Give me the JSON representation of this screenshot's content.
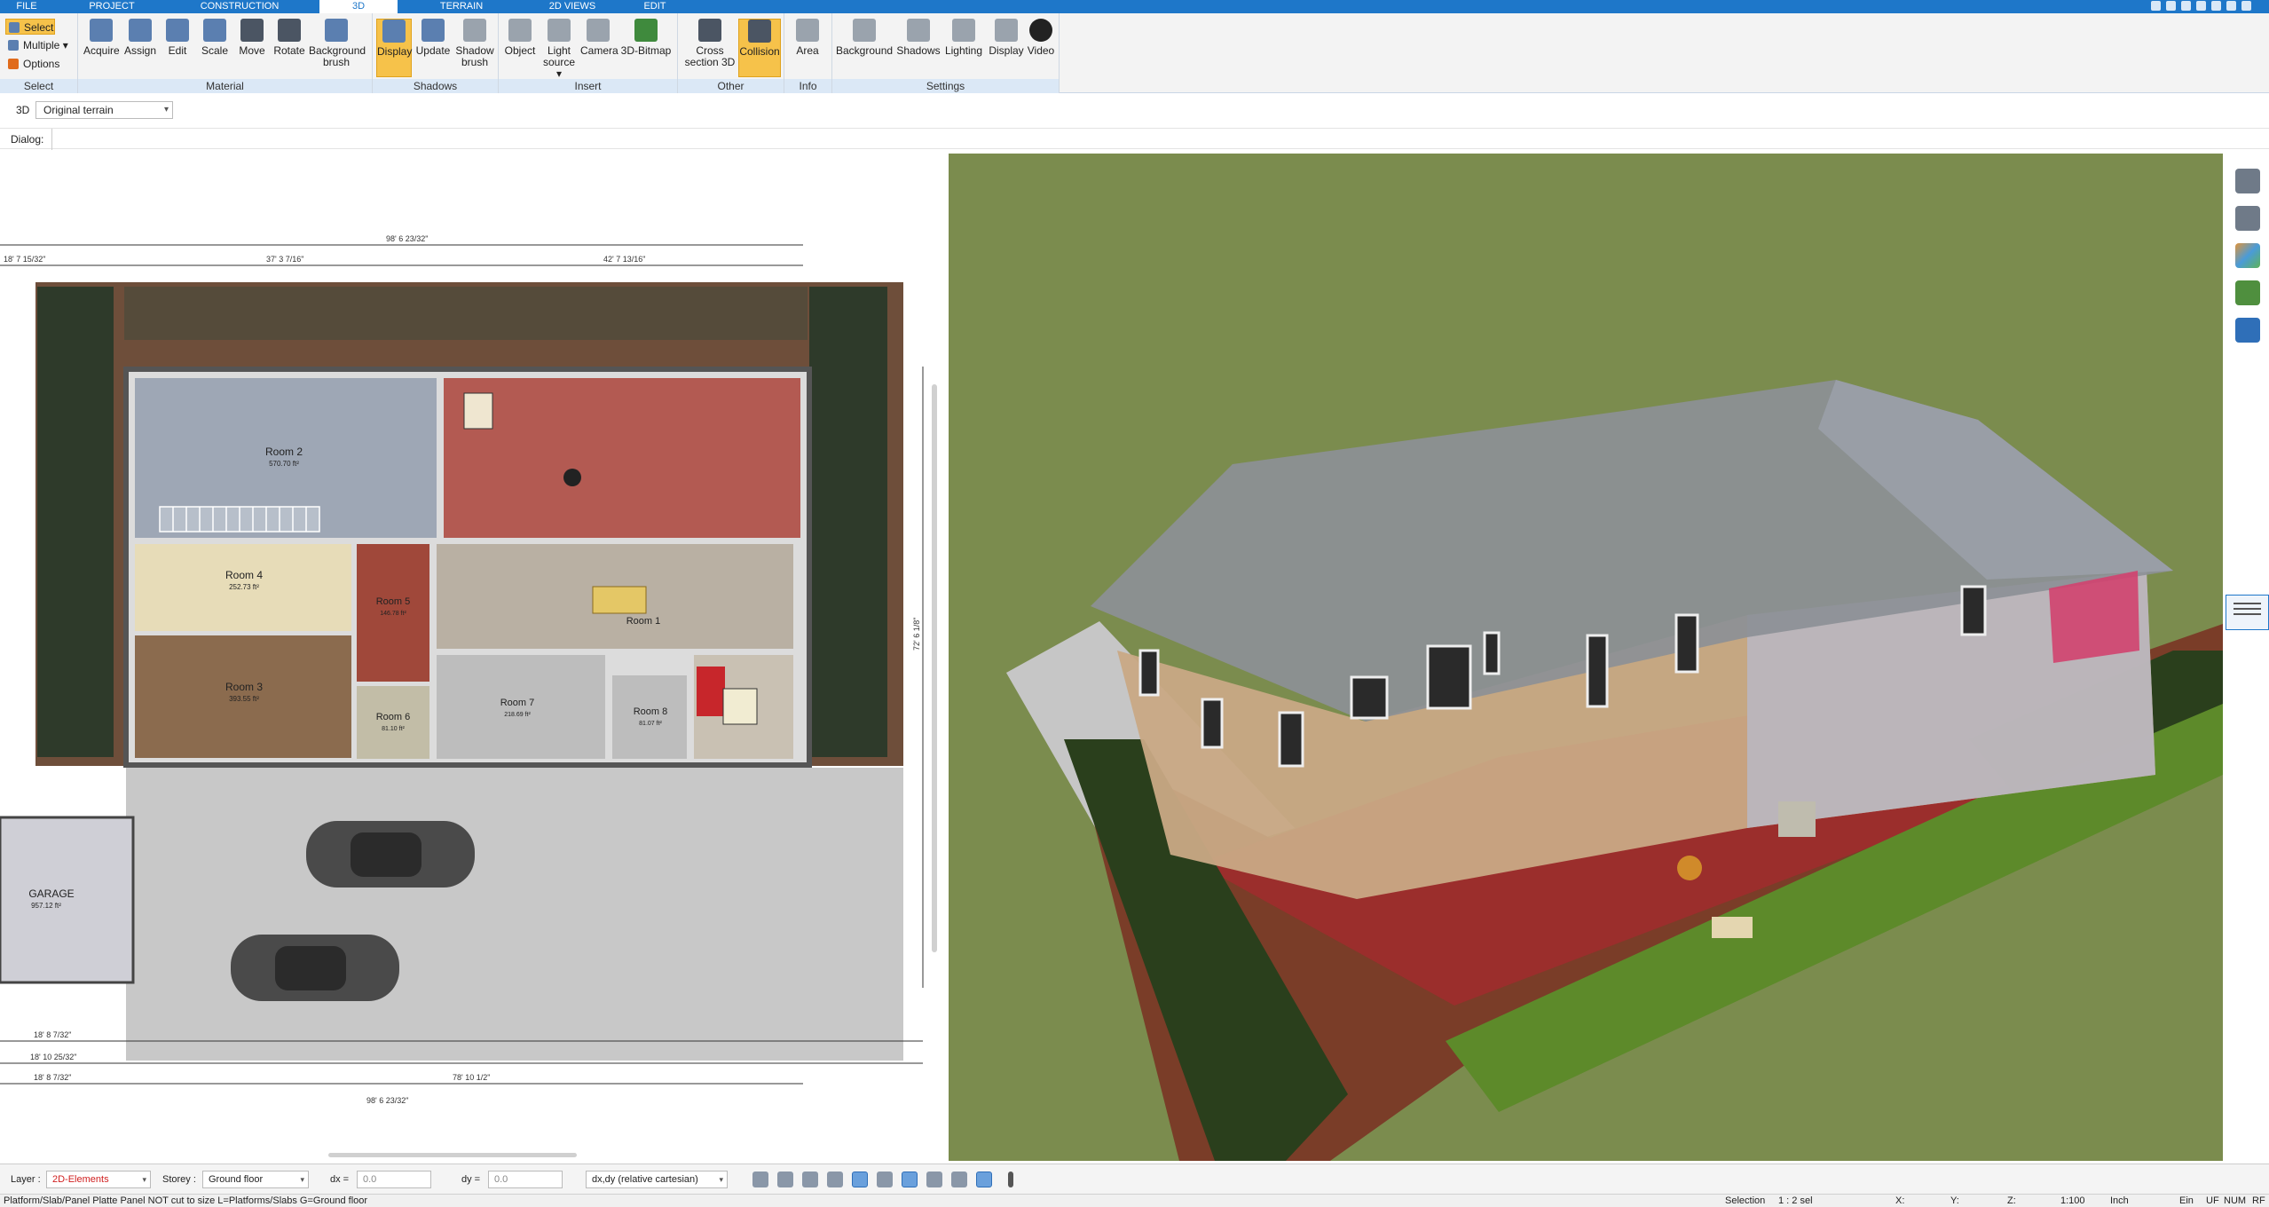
{
  "menu_tabs": [
    "FILE",
    "PROJECT",
    "CONSTRUCTION",
    "3D",
    "TERRAIN",
    "2D VIEWS",
    "EDIT"
  ],
  "ribbon": {
    "select_group": {
      "select": "Select",
      "multiple": "Multiple",
      "options": "Options",
      "label": "Select"
    },
    "material_group": {
      "buttons": [
        "Acquire",
        "Assign",
        "Edit",
        "Scale",
        "Move",
        "Rotate"
      ],
      "background_brush": [
        "Background",
        "brush"
      ],
      "label": "Material"
    },
    "shadows_group": {
      "display": "Display",
      "update": "Update",
      "shadow_brush": [
        "Shadow",
        "brush"
      ],
      "label": "Shadows"
    },
    "insert_group": {
      "object": "Object",
      "light_source": [
        "Light",
        "source"
      ],
      "camera": "Camera",
      "bitmap": "3D-Bitmap",
      "label": "Insert"
    },
    "other_group": {
      "cross_section": [
        "Cross",
        "section 3D"
      ],
      "collision": "Collision",
      "label": "Other"
    },
    "info_group": {
      "area": "Area",
      "label": "Info"
    },
    "settings_group": {
      "buttons": [
        "Background",
        "Shadows",
        "Lighting",
        "Display",
        "Video"
      ],
      "label": "Settings"
    }
  },
  "context": {
    "mode": "3D",
    "terrain": "Original terrain",
    "dialog_label": "Dialog:"
  },
  "plan": {
    "rooms": [
      {
        "name": "Room 2",
        "area": "570.70 ft²"
      },
      {
        "name": "Room 4",
        "area": "252.73 ft²"
      },
      {
        "name": "Room 3",
        "area": "393.55 ft²"
      },
      {
        "name": "Room 5",
        "area": "146.78 ft²"
      },
      {
        "name": "Room 1",
        "area": ""
      },
      {
        "name": "Room 6",
        "area": "81.10 ft²"
      },
      {
        "name": "Room 7",
        "area": "218.69 ft²"
      },
      {
        "name": "Room 8",
        "area": "81.07 ft²"
      },
      {
        "name": "GARAGE",
        "area": "957.12 ft²"
      }
    ],
    "dimensions": [
      "98' 6 23/32\"",
      "18' 7 15/32\"",
      "37' 3 7/16\"",
      "42' 7 13/16\"",
      "18' 8 7/32\"",
      "18' 10 25/32\"",
      "18' 8 7/32\"",
      "78' 10 1/2\"",
      "98' 6 23/32\"",
      "72' 6 1/8\""
    ]
  },
  "bottombar": {
    "layer_label": "Layer :",
    "layer_value": "2D-Elements",
    "storey_label": "Storey :",
    "storey_value": "Ground floor",
    "dx_label": "dx =",
    "dx_value": "0.0",
    "dy_label": "dy =",
    "dy_value": "0.0",
    "coord_mode": "dx,dy (relative cartesian)"
  },
  "statusbar": {
    "hint": "Platform/Slab/Panel Platte Panel NOT cut to size L=Platforms/Slabs G=Ground floor",
    "selection": "Selection",
    "sel_ratio": "1 : 2 sel",
    "x": "X:",
    "y": "Y:",
    "z": "Z:",
    "scale": "1:100",
    "unit": "Inch",
    "ein": "Ein",
    "uf": "UF",
    "num": "NUM",
    "rf": "RF"
  },
  "colors": {
    "accent": "#1e77c9",
    "active": "#f6c24a",
    "grass": "#7b8c4e",
    "terrace": "#9b2e2c",
    "floor_tile": "#c6c6c6"
  }
}
